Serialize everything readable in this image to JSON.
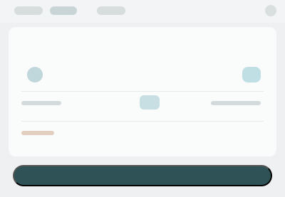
{
  "colors": {
    "background": "#eef0f1",
    "panel": "#fafbfb",
    "accent": "#2f5256",
    "muted_text": "#9aa6a8"
  },
  "topbar": {
    "close_icon": "close-icon"
  },
  "panel": {
    "avatar_icon": "avatar-icon",
    "swap_icon": "swap-icon",
    "token_icon": "token-icon"
  },
  "cta": {
    "label": ""
  }
}
